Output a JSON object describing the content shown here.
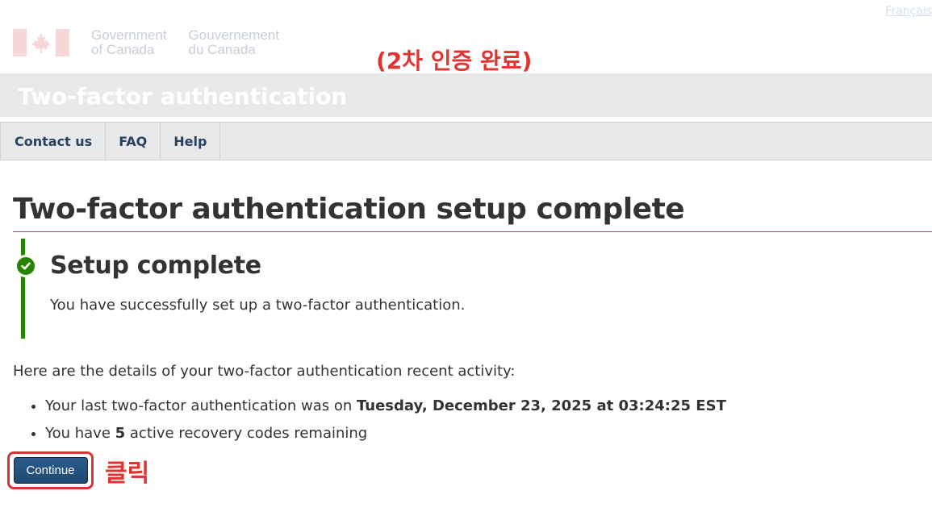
{
  "header": {
    "language_link": "Français",
    "signature": {
      "en_line1": "Government",
      "en_line2": "of Canada",
      "fr_line1": "Gouvernement",
      "fr_line2": "du Canada"
    },
    "app_title": "Two-factor authentication"
  },
  "annotations": {
    "top": "(2차 인증 완료)",
    "click": "클릭",
    "highlight_color": "#e2332e"
  },
  "menu": {
    "items": [
      {
        "label": "Contact us"
      },
      {
        "label": "FAQ"
      },
      {
        "label": "Help"
      }
    ]
  },
  "main": {
    "page_title": "Two-factor authentication setup complete",
    "alert": {
      "status": "success",
      "icon": "check-circle-icon",
      "color": "#278400",
      "heading": "Setup complete",
      "body": "You have successfully set up a two-factor authentication."
    },
    "intro": "Here are the details of your two-factor authentication recent activity:",
    "details": {
      "last_auth_prefix": "Your last two-factor authentication was on ",
      "last_auth_value": "Tuesday, December 23, 2025 at 03:24:25 EST",
      "codes_prefix": "You have ",
      "codes_value": "5",
      "codes_suffix": " active recovery codes remaining"
    },
    "continue_label": "Continue"
  }
}
